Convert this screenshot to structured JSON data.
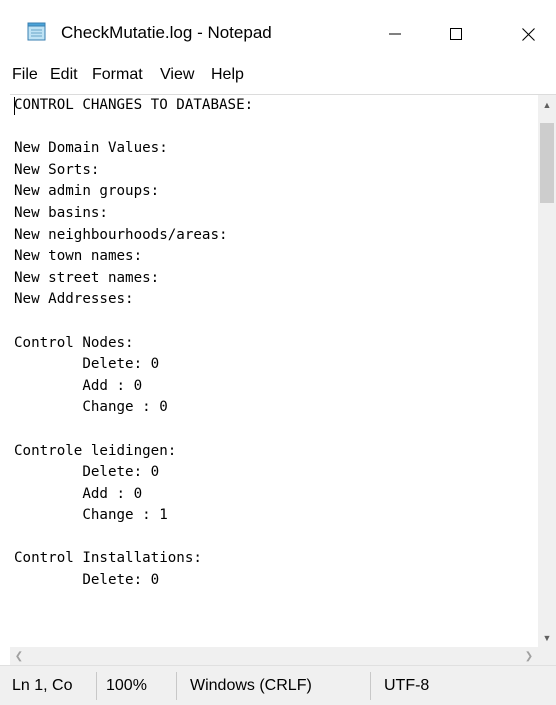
{
  "window": {
    "title": "CheckMutatie.log - Notepad",
    "app_icon": "notepad-icon",
    "controls": {
      "minimize": "minimize-icon",
      "maximize": "maximize-icon",
      "close": "close-icon"
    }
  },
  "menu": {
    "file": "File",
    "edit": "Edit",
    "format": "Format",
    "view": "View",
    "help": "Help"
  },
  "editor": {
    "content": "CONTROL CHANGES TO DATABASE:\n\nNew Domain Values:\nNew Sorts:\nNew admin groups:\nNew basins:\nNew neighbourhoods/areas:\nNew town names:\nNew street names:\nNew Addresses:\n\nControl Nodes:\n        Delete: 0\n        Add : 0\n        Change : 0\n\nControle leidingen:\n        Delete: 0\n        Add : 0\n        Change : 1\n\nControl Installations:\n        Delete: 0"
  },
  "status": {
    "position": "Ln 1, Co",
    "zoom": "100%",
    "line_ending": "Windows (CRLF)",
    "encoding": "UTF-8"
  },
  "colors": {
    "background": "#ffffff",
    "chrome": "#f0f0f0",
    "scroll_thumb": "#cdcdcd"
  }
}
